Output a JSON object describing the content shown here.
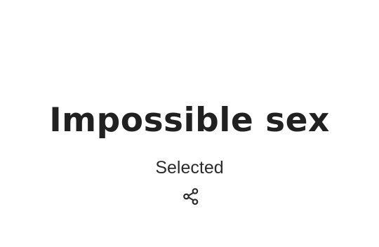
{
  "puzzle": {
    "title": "Impossible sex",
    "status": "Selected"
  },
  "actions": {
    "share_icon": "share-icon"
  },
  "colors": {
    "text_primary": "#212121",
    "text_secondary": "#2b2b2b",
    "background": "#ffffff"
  }
}
